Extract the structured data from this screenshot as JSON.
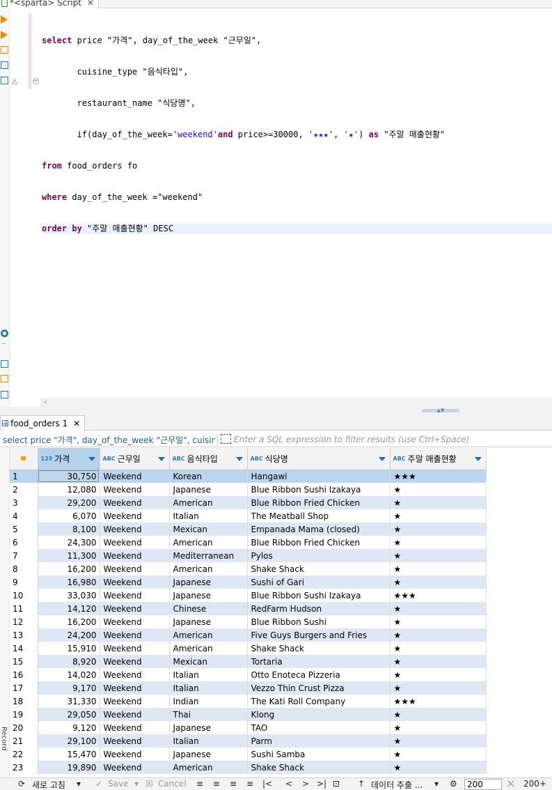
{
  "editor_tab": {
    "title": "*<sparta> Script",
    "close": "✕"
  },
  "code": {
    "l1_a": "select",
    "l1_b": " price ",
    "l1_c": "\"가격\"",
    "l1_d": ", day_of_the_week ",
    "l1_e": "\"근무일\"",
    "l1_f": ",",
    "l2_a": "       cuisine_type ",
    "l2_b": "\"음식타입\"",
    "l2_c": ",",
    "l3_a": "       restaurant_name ",
    "l3_b": "\"식당명\"",
    "l3_c": ",",
    "l4_a": "       if(day_of_the_week=",
    "l4_b": "'weekend'",
    "l4_c": "and",
    "l4_d": " price>=30000, ",
    "l4_e": "'★★★'",
    "l4_f": ", ",
    "l4_g": "'★'",
    "l4_h": ") ",
    "l4_i": "as",
    "l4_j": " ",
    "l4_k": "\"주말 매출현황\"",
    "l5_a": "from",
    "l5_b": " food_orders fo",
    "l6_a": "where",
    "l6_b": " day_of_the_week =",
    "l6_c": "\"weekend\"",
    "l7_a": "order by",
    "l7_b": " ",
    "l7_c": "\"주말 매출현황\"",
    "l7_d": " DESC"
  },
  "results_tab": {
    "title": "food_orders 1",
    "close": "✕"
  },
  "filter": {
    "query": "select price \"가격\", day_of_the_week \"근무일\", cuisine_",
    "placeholder": "Enter a SQL expression to filter results (use Ctrl+Space)"
  },
  "columns": [
    {
      "type": "123",
      "label": "가격"
    },
    {
      "type": "ABC",
      "label": "근무일"
    },
    {
      "type": "ABC",
      "label": "음식타입"
    },
    {
      "type": "ABC",
      "label": "식당명"
    },
    {
      "type": "ABC",
      "label": "주말 매출현황"
    }
  ],
  "rows": [
    [
      "1",
      "30,750",
      "Weekend",
      "Korean",
      "Hangawi",
      "★★★"
    ],
    [
      "2",
      "12,080",
      "Weekend",
      "Japanese",
      "Blue Ribbon Sushi Izakaya",
      "★"
    ],
    [
      "3",
      "29,200",
      "Weekend",
      "American",
      "Blue Ribbon Fried Chicken",
      "★"
    ],
    [
      "4",
      "6,070",
      "Weekend",
      "Italian",
      "The Meatball Shop",
      "★"
    ],
    [
      "5",
      "8,100",
      "Weekend",
      "Mexican",
      "Empanada Mama (closed)",
      "★"
    ],
    [
      "6",
      "24,300",
      "Weekend",
      "American",
      "Blue Ribbon Fried Chicken",
      "★"
    ],
    [
      "7",
      "11,300",
      "Weekend",
      "Mediterranean",
      "Pylos",
      "★"
    ],
    [
      "8",
      "16,200",
      "Weekend",
      "American",
      "Shake Shack",
      "★"
    ],
    [
      "9",
      "16,980",
      "Weekend",
      "Japanese",
      "Sushi of Gari",
      "★"
    ],
    [
      "10",
      "33,030",
      "Weekend",
      "Japanese",
      "Blue Ribbon Sushi Izakaya",
      "★★★"
    ],
    [
      "11",
      "14,120",
      "Weekend",
      "Chinese",
      "RedFarm Hudson",
      "★"
    ],
    [
      "12",
      "16,200",
      "Weekend",
      "Japanese",
      "Blue Ribbon Sushi",
      "★"
    ],
    [
      "13",
      "24,200",
      "Weekend",
      "American",
      "Five Guys Burgers and Fries",
      "★"
    ],
    [
      "14",
      "15,910",
      "Weekend",
      "American",
      "Shake Shack",
      "★"
    ],
    [
      "15",
      "8,920",
      "Weekend",
      "Mexican",
      "Tortaria",
      "★"
    ],
    [
      "16",
      "14,020",
      "Weekend",
      "Italian",
      "Otto Enoteca Pizzeria",
      "★"
    ],
    [
      "17",
      "9,170",
      "Weekend",
      "Italian",
      "Vezzo Thin Crust Pizza",
      "★"
    ],
    [
      "18",
      "31,330",
      "Weekend",
      "Indian",
      "The Kati Roll Company",
      "★★★"
    ],
    [
      "19",
      "29,050",
      "Weekend",
      "Thai",
      "Klong",
      "★"
    ],
    [
      "20",
      "9,120",
      "Weekend",
      "Japanese",
      "TAO",
      "★"
    ],
    [
      "21",
      "29,100",
      "Weekend",
      "Italian",
      "Parm",
      "★"
    ],
    [
      "22",
      "15,470",
      "Weekend",
      "Japanese",
      "Sushi Samba",
      "★"
    ],
    [
      "23",
      "19,890",
      "Weekend",
      "American",
      "Shake Shack",
      "★"
    ]
  ],
  "side_panel": {
    "record_label": "Record"
  },
  "bottom": {
    "refresh": "새로 고침",
    "save": "Save",
    "cancel": "Cancel",
    "export": "데이터 추출 ...",
    "fetch_size": "200",
    "row_count": "200+"
  }
}
